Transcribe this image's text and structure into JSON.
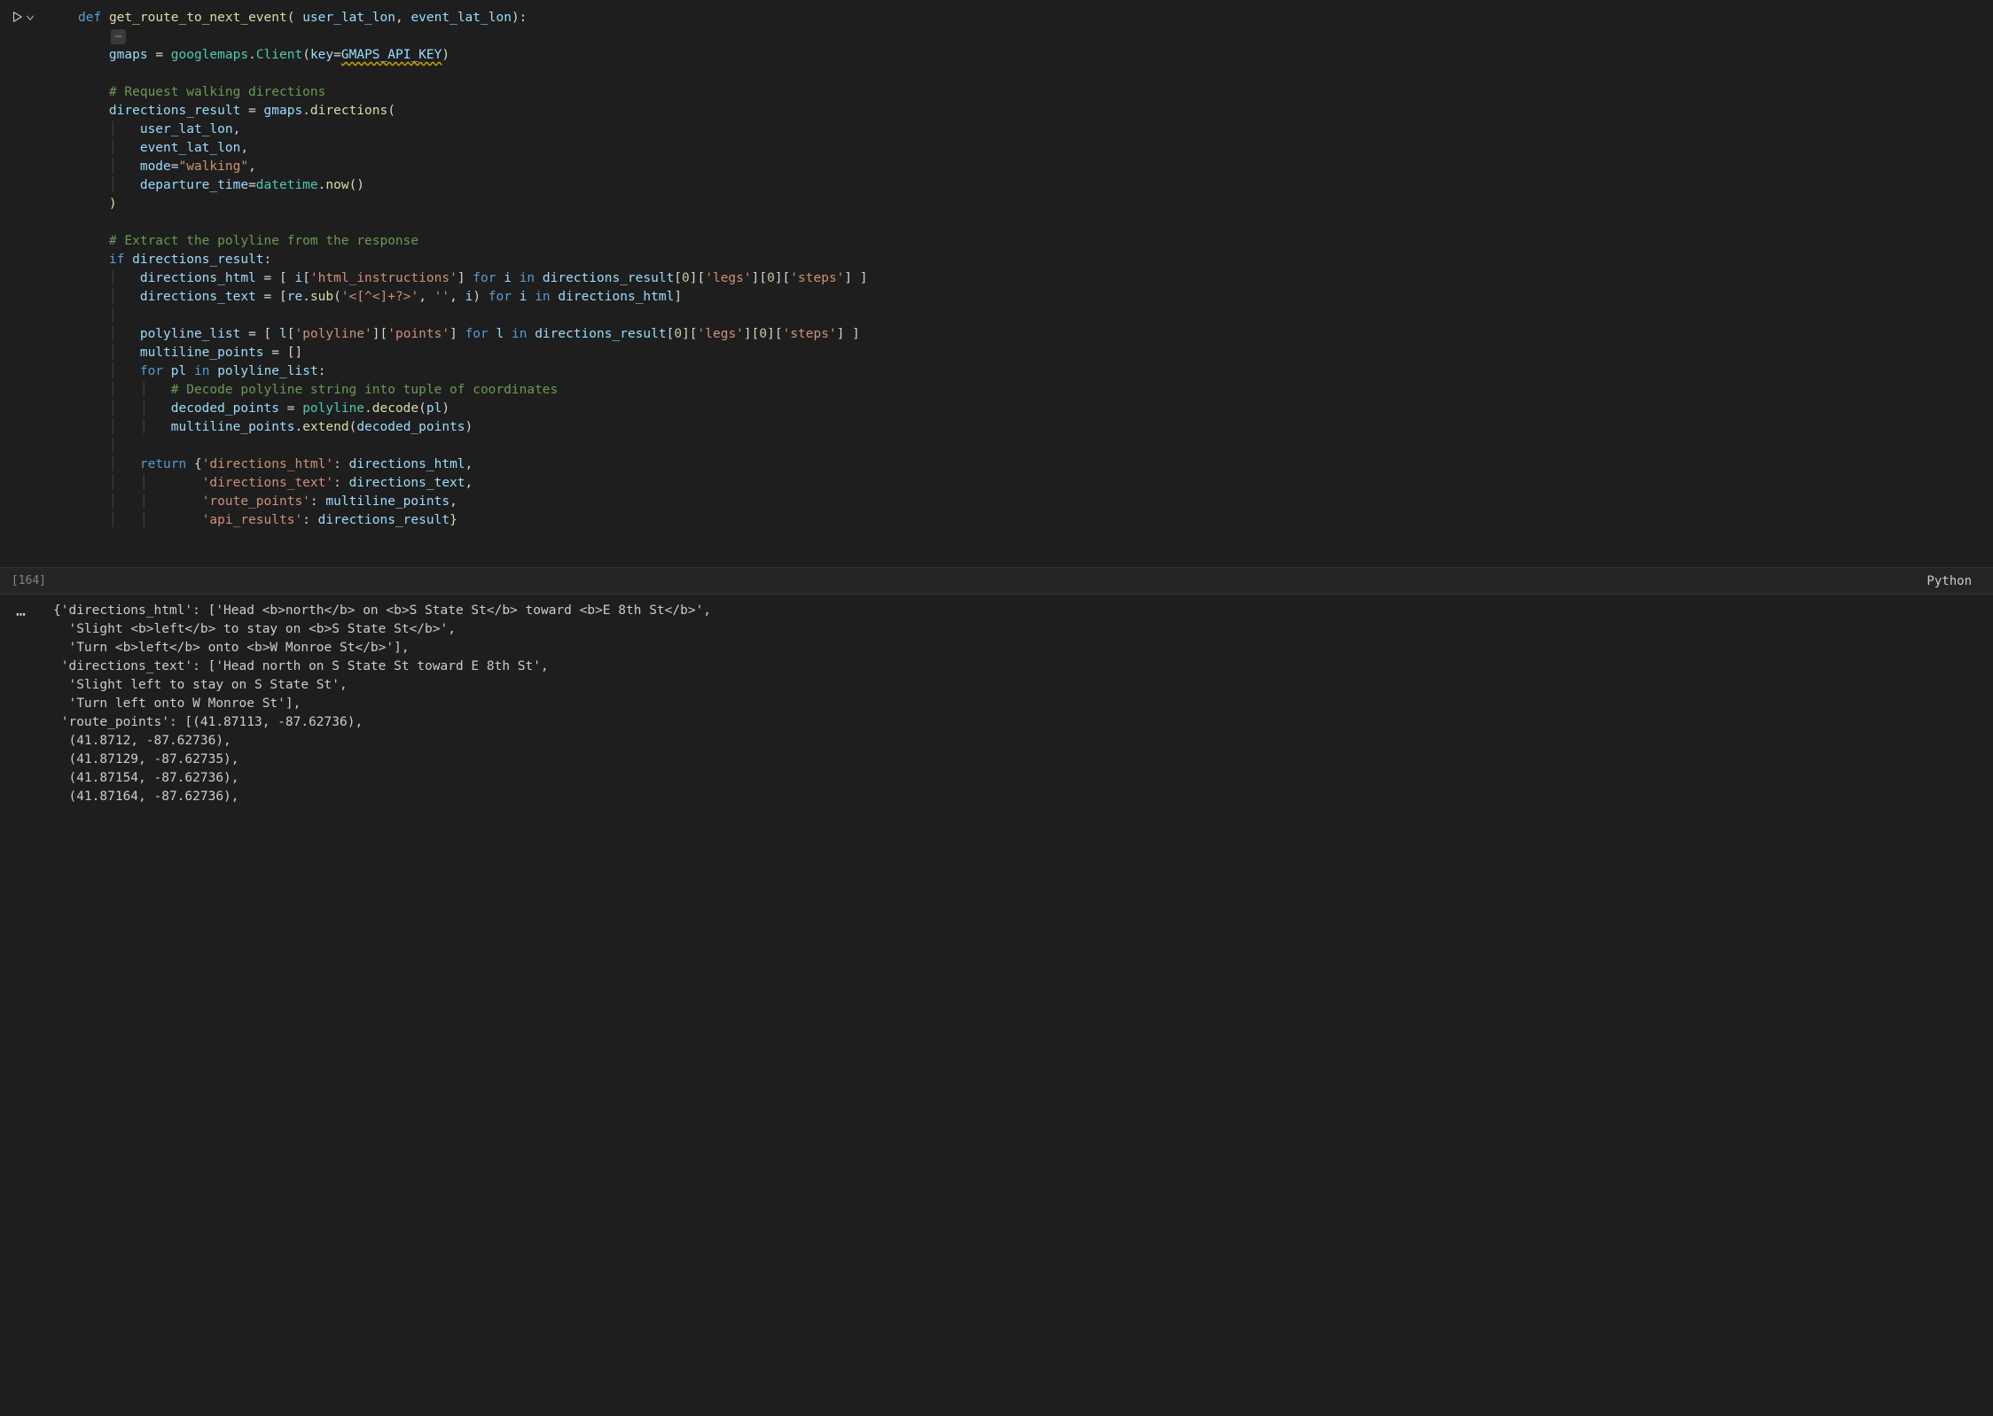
{
  "cell": {
    "exec_count": "[164]",
    "language": "Python",
    "fold_placeholder": "⋯",
    "code_tokens": {
      "l1": {
        "def": "def",
        "sp": " ",
        "fn": "get_route_to_next_event",
        "open": "( ",
        "p1": "user_lat_lon",
        "c": ", ",
        "p2": "event_lat_lon",
        "close": "):"
      },
      "l4_assign": "gmaps = ",
      "l4_mod": "googlemaps",
      "l4_dot": ".",
      "l4_cls": "Client",
      "l4_open": "(",
      "l4_kw": "key",
      "l4_eq": "=",
      "l4_const": "GMAPS_API_KEY",
      "l4_close": ")",
      "l6_cmt": "# Request walking directions",
      "l7a": "directions_result = gmaps.",
      "l7_fn": "directions",
      "l7b": "(",
      "l8": "user_lat_lon,",
      "l9": "event_lat_lon,",
      "l10a": "mode",
      "l10b": "=",
      "l10c": "\"walking\"",
      "l10d": ",",
      "l11a": "departure_time",
      "l11b": "=",
      "l11c": "datetime",
      "l11d": ".",
      "l11e": "now",
      "l11f": "()",
      "l12": ")",
      "l14_cmt": "# Extract the polyline from the response",
      "l15a": "if",
      "l15b": " directions_result:",
      "l16": "directions_html = [ i['html_instructions'] for i in directions_result[0]['legs'][0]['steps'] ]",
      "l17": "directions_text = [re.sub('<[^<]+?>', '', i) for i in directions_html]",
      "l19": "polyline_list = [ l['polyline']['points'] for l in directions_result[0]['legs'][0]['steps'] ]",
      "l20": "multiline_points = []",
      "l21a": "for",
      "l21b": " pl ",
      "l21c": "in",
      "l21d": " polyline_list:",
      "l22_cmt": "# Decode polyline string into tuple of coordinates",
      "l23": "decoded_points = polyline.decode(pl)",
      "l24": "multiline_points.extend(decoded_points)",
      "l26a": "return",
      "l26b": " {",
      "l26c": "'directions_html'",
      "l26d": ": directions_html,",
      "l27a": "'directions_text'",
      "l27b": ": directions_text,",
      "l28a": "'route_points'",
      "l28b": ": multiline_points,",
      "l29a": "'api_results'",
      "l29b": ": directions_result}"
    }
  },
  "output": {
    "ellipsis": "⋯",
    "lines": [
      "{'directions_html': ['Head <b>north</b> on <b>S State St</b> toward <b>E 8th St</b>',",
      "  'Slight <b>left</b> to stay on <b>S State St</b>',",
      "  'Turn <b>left</b> onto <b>W Monroe St</b>'],",
      " 'directions_text': ['Head north on S State St toward E 8th St',",
      "  'Slight left to stay on S State St',",
      "  'Turn left onto W Monroe St'],",
      " 'route_points': [(41.87113, -87.62736),",
      "  (41.8712, -87.62736),",
      "  (41.87129, -87.62735),",
      "  (41.87154, -87.62736),",
      "  (41.87164, -87.62736),"
    ]
  }
}
